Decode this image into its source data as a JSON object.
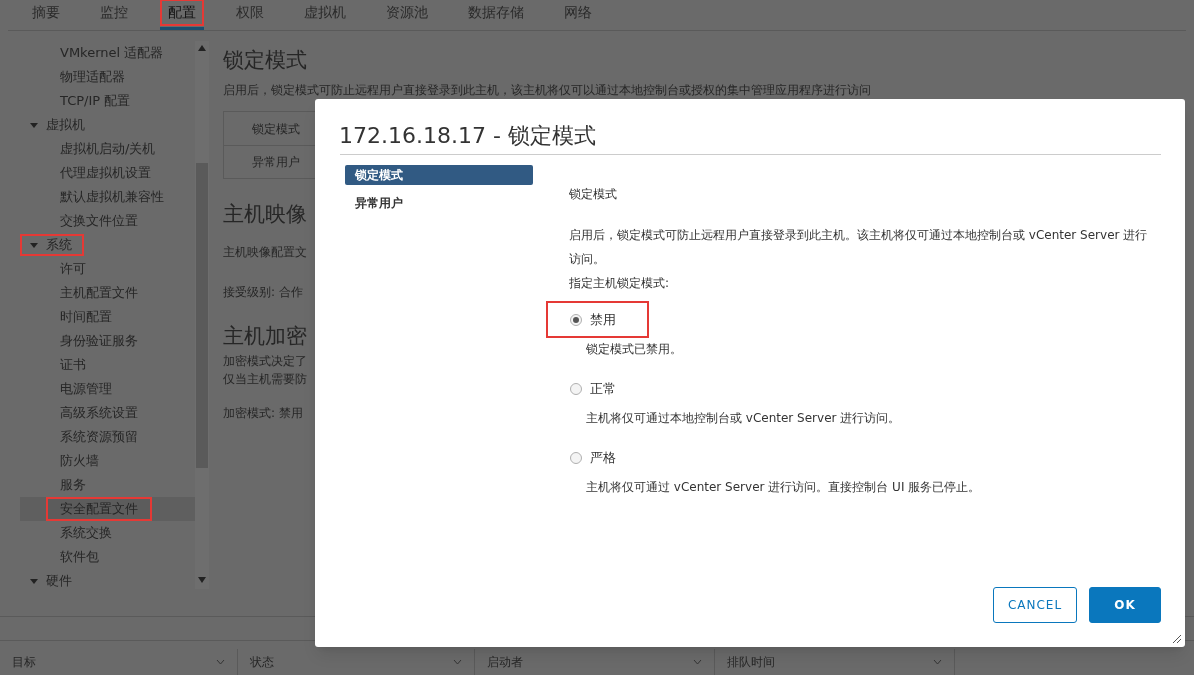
{
  "top_tabs": [
    {
      "label": "摘要",
      "selected": false,
      "annotated": false
    },
    {
      "label": "监控",
      "selected": false,
      "annotated": false
    },
    {
      "label": "配置",
      "selected": true,
      "annotated": true
    },
    {
      "label": "权限",
      "selected": false,
      "annotated": false
    },
    {
      "label": "虚拟机",
      "selected": false,
      "annotated": false
    },
    {
      "label": "资源池",
      "selected": false,
      "annotated": false
    },
    {
      "label": "数据存储",
      "selected": false,
      "annotated": false
    },
    {
      "label": "网络",
      "selected": false,
      "annotated": false
    }
  ],
  "sidebar": {
    "items": [
      {
        "kind": "leaf",
        "label": "VMkernel 适配器",
        "selected": false,
        "annotated": false
      },
      {
        "kind": "leaf",
        "label": "物理适配器",
        "selected": false,
        "annotated": false
      },
      {
        "kind": "leaf",
        "label": "TCP/IP 配置",
        "selected": false,
        "annotated": false
      },
      {
        "kind": "group",
        "label": "虚拟机",
        "expanded": true,
        "annotated": false,
        "children": [
          {
            "kind": "leaf",
            "label": "虚拟机启动/关机",
            "selected": false,
            "annotated": false
          },
          {
            "kind": "leaf",
            "label": "代理虚拟机设置",
            "selected": false,
            "annotated": false
          },
          {
            "kind": "leaf",
            "label": "默认虚拟机兼容性",
            "selected": false,
            "annotated": false
          },
          {
            "kind": "leaf",
            "label": "交换文件位置",
            "selected": false,
            "annotated": false
          }
        ]
      },
      {
        "kind": "group",
        "label": "系统",
        "expanded": true,
        "annotated": true,
        "children": [
          {
            "kind": "leaf",
            "label": "许可",
            "selected": false,
            "annotated": false
          },
          {
            "kind": "leaf",
            "label": "主机配置文件",
            "selected": false,
            "annotated": false
          },
          {
            "kind": "leaf",
            "label": "时间配置",
            "selected": false,
            "annotated": false
          },
          {
            "kind": "leaf",
            "label": "身份验证服务",
            "selected": false,
            "annotated": false
          },
          {
            "kind": "leaf",
            "label": "证书",
            "selected": false,
            "annotated": false
          },
          {
            "kind": "leaf",
            "label": "电源管理",
            "selected": false,
            "annotated": false
          },
          {
            "kind": "leaf",
            "label": "高级系统设置",
            "selected": false,
            "annotated": false
          },
          {
            "kind": "leaf",
            "label": "系统资源预留",
            "selected": false,
            "annotated": false
          },
          {
            "kind": "leaf",
            "label": "防火墙",
            "selected": false,
            "annotated": false
          },
          {
            "kind": "leaf",
            "label": "服务",
            "selected": false,
            "annotated": false
          },
          {
            "kind": "leaf",
            "label": "安全配置文件",
            "selected": true,
            "annotated": true
          },
          {
            "kind": "leaf",
            "label": "系统交换",
            "selected": false,
            "annotated": false
          },
          {
            "kind": "leaf",
            "label": "软件包",
            "selected": false,
            "annotated": false
          }
        ]
      },
      {
        "kind": "group",
        "label": "硬件",
        "expanded": true,
        "annotated": false
      }
    ]
  },
  "content": {
    "title": "锁定模式",
    "description": "启用后，锁定模式可防止远程用户直接登录到此主机，该主机将仅可以通过本地控制台或授权的集中管理应用程序进行访问",
    "subtabs": [
      "锁定模式",
      "异常用户"
    ],
    "sections": [
      {
        "heading": "主机映像",
        "lines": [
          "主机映像配置文",
          "接受级别: 合作"
        ]
      },
      {
        "heading": "主机加密",
        "lines": [
          "加密模式决定了",
          "仅当主机需要防",
          "加密模式: 禁用"
        ]
      }
    ]
  },
  "bottom_table": {
    "columns": [
      "目标",
      "状态",
      "启动者",
      "排队时间"
    ]
  },
  "dialog": {
    "title": "172.16.18.17 - 锁定模式",
    "nav": [
      {
        "label": "锁定模式",
        "selected": true
      },
      {
        "label": "异常用户",
        "selected": false
      }
    ],
    "section_label": "锁定模式",
    "description": "启用后，锁定模式可防止远程用户直接登录到此主机。该主机将仅可通过本地控制台或 vCenter Server 进行访问。",
    "prompt": "指定主机锁定模式:",
    "options": [
      {
        "label": "禁用",
        "description": "锁定模式已禁用。",
        "selected": true,
        "annotated": true
      },
      {
        "label": "正常",
        "description": "主机将仅可通过本地控制台或 vCenter Server 进行访问。",
        "selected": false,
        "annotated": false
      },
      {
        "label": "严格",
        "description": "主机将仅可通过 vCenter Server 进行访问。直接控制台 UI 服务已停止。",
        "selected": false,
        "annotated": false
      }
    ],
    "buttons": [
      {
        "label": "CANCEL",
        "kind": "secondary"
      },
      {
        "label": "OK",
        "kind": "primary"
      }
    ]
  }
}
